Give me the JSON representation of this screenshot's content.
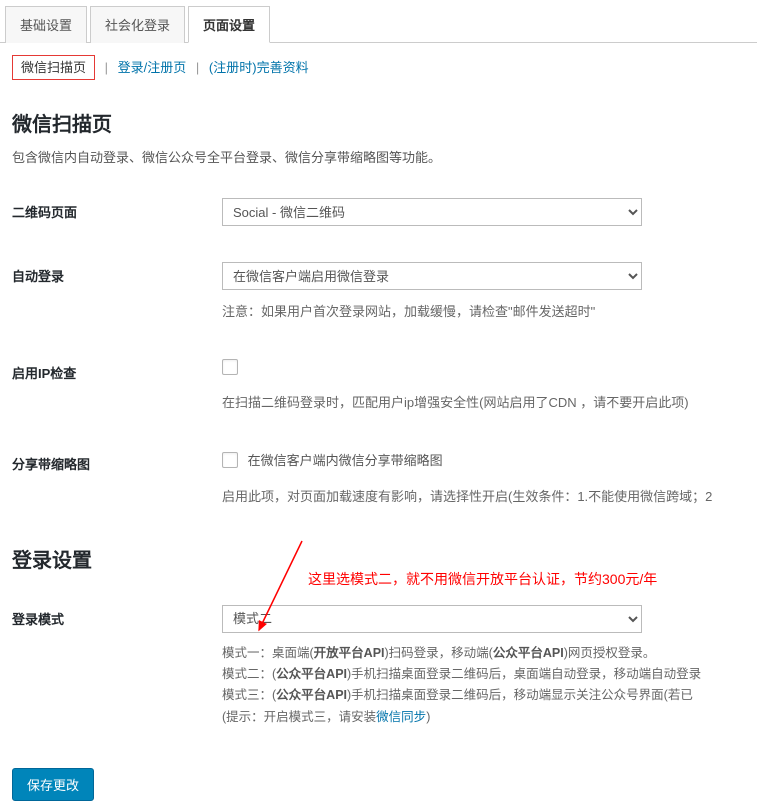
{
  "tabs": {
    "items": [
      {
        "label": "基础设置"
      },
      {
        "label": "社会化登录"
      },
      {
        "label": "页面设置"
      }
    ],
    "active_index": 2
  },
  "subtabs": {
    "items": [
      {
        "label": "微信扫描页"
      },
      {
        "label": "登录/注册页"
      },
      {
        "label": "(注册时)完善资料"
      }
    ],
    "active_index": 0
  },
  "section1": {
    "title": "微信扫描页",
    "desc": "包含微信内自动登录、微信公众号全平台登录、微信分享带缩略图等功能。"
  },
  "fields": {
    "qrcode_page": {
      "label": "二维码页面",
      "value": "Social - 微信二维码"
    },
    "auto_login": {
      "label": "自动登录",
      "value": "在微信客户端启用微信登录",
      "note": "注意：如果用户首次登录网站，加载缓慢，请检查\"邮件发送超时\""
    },
    "ip_check": {
      "label": "启用IP检查",
      "note": "在扫描二维码登录时，匹配用户ip增强安全性(网站启用了CDN ，请不要开启此项)"
    },
    "share_thumb": {
      "label": "分享带缩略图",
      "checkbox_label": "在微信客户端内微信分享带缩略图",
      "note": "启用此项，对页面加载速度有影响，请选择性开启(生效条件：1.不能使用微信跨域；2"
    }
  },
  "section2": {
    "title": "登录设置"
  },
  "login_mode": {
    "label": "登录模式",
    "value": "模式二",
    "annotation": "这里选模式二，就不用微信开放平台认证，节约300元/年",
    "desc": {
      "line1_prefix": "模式一：桌面端(",
      "line1_b1": "开放平台API",
      "line1_mid": ")扫码登录，移动端(",
      "line1_b2": "公众平台API",
      "line1_suffix": ")网页授权登录。",
      "line2_prefix": "模式二：(",
      "line2_b": "公众平台API",
      "line2_suffix": ")手机扫描桌面登录二维码后，桌面端自动登录，移动端自动登录",
      "line3_prefix": "模式三：(",
      "line3_b": "公众平台API",
      "line3_suffix": ")手机扫描桌面登录二维码后，移动端显示关注公众号界面(若已",
      "line4_prefix": "(提示：开启模式三，请安装",
      "line4_link": "微信同步",
      "line4_suffix": ")"
    }
  },
  "save": {
    "label": "保存更改"
  }
}
